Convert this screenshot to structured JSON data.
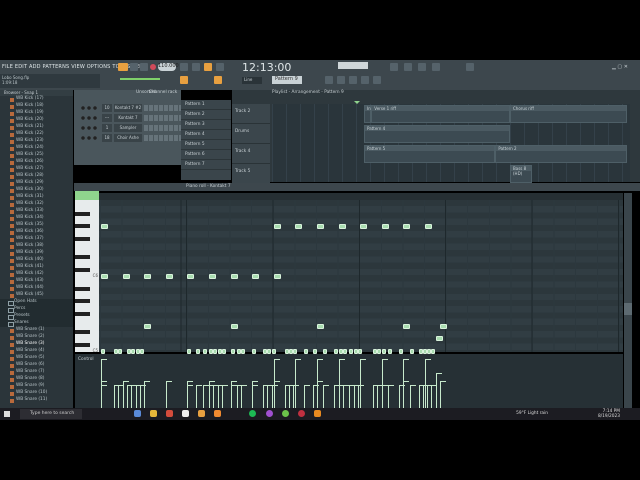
{
  "menu": "FILE EDIT ADD PATTERNS VIEW OPTIONS TOOLS HELP",
  "hint": {
    "file": "Lobo Song.flp",
    "time": "1:09:18"
  },
  "transport": {
    "tempo": "110.000",
    "clock": "12:13:00",
    "pattern": "Pattern 9",
    "snap": "Line"
  },
  "browser": {
    "title": "Browser - Snap 1",
    "items": [
      {
        "label": "WB Kick (17)"
      },
      {
        "label": "WB Kick (18)"
      },
      {
        "label": "WB Kick (19)"
      },
      {
        "label": "WB Kick (20)"
      },
      {
        "label": "WB Kick (21)"
      },
      {
        "label": "WB Kick (22)"
      },
      {
        "label": "WB Kick (23)"
      },
      {
        "label": "WB Kick (24)"
      },
      {
        "label": "WB Kick (25)"
      },
      {
        "label": "WB Kick (26)"
      },
      {
        "label": "WB Kick (27)"
      },
      {
        "label": "WB Kick (28)"
      },
      {
        "label": "WB Kick (29)"
      },
      {
        "label": "WB Kick (30)"
      },
      {
        "label": "WB Kick (31)"
      },
      {
        "label": "WB Kick (32)"
      },
      {
        "label": "WB Kick (33)"
      },
      {
        "label": "WB Kick (34)"
      },
      {
        "label": "WB Kick (35)"
      },
      {
        "label": "WB Kick (36)"
      },
      {
        "label": "WB Kick (37)"
      },
      {
        "label": "WB Kick (38)"
      },
      {
        "label": "WB Kick (39)"
      },
      {
        "label": "WB Kick (40)"
      },
      {
        "label": "WB Kick (41)"
      },
      {
        "label": "WB Kick (42)"
      },
      {
        "label": "WB Kick (43)"
      },
      {
        "label": "WB Kick (44)"
      },
      {
        "label": "WB Kick (45)"
      },
      {
        "label": "Open Hats",
        "folder": true
      },
      {
        "label": "Percs",
        "folder": true
      },
      {
        "label": "Presets",
        "folder": true
      },
      {
        "label": "Snares",
        "folder": true
      },
      {
        "label": "WB Snare (1)"
      },
      {
        "label": "WB Snare (2)"
      },
      {
        "label": "WB Snare (3)",
        "selected": true
      },
      {
        "label": "WB Snare (4)"
      },
      {
        "label": "WB Snare (5)"
      },
      {
        "label": "WB Snare (6)"
      },
      {
        "label": "WB Snare (7)"
      },
      {
        "label": "WB Snare (8)"
      },
      {
        "label": "WB Snare (9)"
      },
      {
        "label": "WB Snare (10)"
      },
      {
        "label": "WB Snare (11)"
      }
    ]
  },
  "channel_rack": {
    "title": "Channel rack",
    "filter": "Unsorted",
    "channels": [
      {
        "num": "10",
        "name": "Kontakt 7 #2"
      },
      {
        "num": "---",
        "name": "Kontakt 7"
      },
      {
        "num": "1",
        "name": "Sampler"
      },
      {
        "num": "18",
        "name": "Choir Ashe"
      }
    ]
  },
  "patterns": [
    "Pattern 1",
    "Pattern 2",
    "Pattern 3",
    "Pattern 4",
    "Pattern 5",
    "Pattern 6",
    "Pattern 7"
  ],
  "playlist": {
    "title": "Playlist - Arrangement - Pattern 9",
    "tracks": [
      "Track 2",
      "Drums",
      "Track 4",
      "Track 5"
    ],
    "clips": [
      {
        "track": 0,
        "start": 0,
        "len": 1,
        "label": "Int"
      },
      {
        "track": 0,
        "start": 1,
        "len": 19,
        "label": "Verse 1 riff"
      },
      {
        "track": 0,
        "start": 20,
        "len": 16,
        "label": "Chorus riff"
      },
      {
        "track": 1,
        "start": 0,
        "len": 20,
        "label": "Pattern 4"
      },
      {
        "track": 2,
        "start": 0,
        "len": 18,
        "label": "Pattern 5"
      },
      {
        "track": 2,
        "start": 18,
        "len": 18,
        "label": "Pattern 2"
      },
      {
        "track": 3,
        "start": 20,
        "len": 3,
        "label": "Bass 8 (HD)"
      }
    ]
  },
  "piano_roll": {
    "title": "Piano roll - Kontakt 7",
    "control_label": "Control",
    "key_labels": [
      "C6",
      "C5"
    ],
    "notes": [
      {
        "pitch": 8,
        "steps": [
          0,
          8,
          9,
          10,
          11,
          12,
          13,
          14,
          15
        ],
        "vel": 1
      },
      {
        "pitch": 0,
        "steps": [
          0,
          1,
          2,
          3,
          4,
          5,
          6,
          7,
          8
        ],
        "vel": 0.55
      },
      {
        "pitch": -8,
        "steps": [
          2,
          6,
          10,
          14,
          15.7
        ],
        "vel": 0.55
      },
      {
        "pitch": -10,
        "steps": [
          15.5
        ],
        "vel": 0.7
      },
      {
        "pitch": -12,
        "steps": [
          0,
          0.6,
          0.8,
          1.2,
          1.4,
          1.6,
          1.8,
          4,
          4.4,
          4.7,
          5,
          5.2,
          5.4,
          5.6,
          6,
          6.3,
          6.5,
          7,
          7.5,
          7.7,
          7.9,
          8.5,
          8.7,
          8.9,
          9.4,
          9.8,
          10.3,
          10.8,
          11,
          11.2,
          11.5,
          11.7,
          11.9,
          12.6,
          12.8,
          13,
          13.3,
          13.8,
          14.3,
          14.7,
          14.9,
          15.1,
          15.3
        ],
        "vel": 0.45
      }
    ]
  },
  "taskbar": {
    "search": "Type here to search",
    "weather": "59°F Light rain",
    "time": "7:14 PM",
    "date": "8/19/2023"
  },
  "colors": {
    "note": "#a9dcb0",
    "accent": "#e8a040",
    "panel": "#3d474d"
  }
}
